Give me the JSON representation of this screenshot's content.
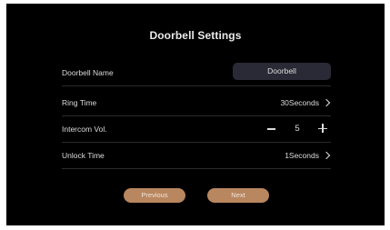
{
  "title": "Doorbell Settings",
  "rows": {
    "doorbell_name": {
      "label": "Doorbell  Name",
      "value": "Doorbell"
    },
    "ring_time": {
      "label": "Ring Time",
      "value": "30Seconds"
    },
    "intercom_vol": {
      "label": "Intercom Vol.",
      "value": "5"
    },
    "unlock_time": {
      "label": "Unlock Time",
      "value": "1Seconds"
    }
  },
  "buttons": {
    "previous": "Previous",
    "next": "Next"
  },
  "colors": {
    "background": "#000000",
    "field": "#2a2a36",
    "button": "#b8865f"
  }
}
